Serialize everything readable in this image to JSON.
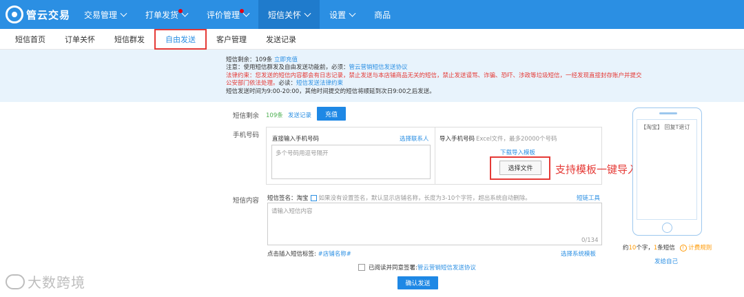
{
  "brand": {
    "logo_text": "管云交易"
  },
  "topnav": [
    {
      "label": "交易管理",
      "caret": true,
      "dot": false
    },
    {
      "label": "打单发货",
      "caret": true,
      "dot": true
    },
    {
      "label": "评价管理",
      "caret": true,
      "dot": true
    },
    {
      "label": "短信关怀",
      "caret": true,
      "dot": false
    },
    {
      "label": "设置",
      "caret": true,
      "dot": false
    },
    {
      "label": "商品",
      "caret": false,
      "dot": false
    }
  ],
  "subtabs": [
    "短信首页",
    "订单关怀",
    "短信群发",
    "自由发送",
    "客户管理",
    "发送记录"
  ],
  "notice": {
    "line1_prefix": "短信剩余：109条 ",
    "line1_link": "立即充值",
    "line2_prefix": "注意：使用短信群发及自由发送功能前，必须：",
    "line2_link": "管云营销短信发送协议",
    "line3": "法律约束：您发送的短信内容都会有日志记录，禁止发送与本店铺商品无关的短信，禁止发送谩骂、诈骗、恐吓、涉政等垃圾短信，一经发现直接封存账户并提交",
    "line4_red": "公安部门依法处理。",
    "line4_mid": "必读：",
    "line4_link": "短信发送法律约束",
    "line5": "短信发送时间为9:00-20:00，其他时间提交的短信将顺延到次日9:00之后发送。"
  },
  "form": {
    "balance_label": "短信剩余",
    "balance_value": "109条",
    "send_record_link": "发送记录",
    "recharge_button": "充值",
    "phone_label": "手机号码",
    "direct_input_title": "直接输入手机号码",
    "choose_contact_link": "选择联系人",
    "phone_placeholder": "多个号码用逗号隔开",
    "import_title": "导入手机号码",
    "import_hint": "Excel文件，最多20000个号码",
    "download_template_link": "下载导入模板",
    "choose_file_button": "选择文件",
    "content_label": "短信内容",
    "signature_label": "短信签名：淘宝",
    "signature_hint": "如果没有设置签名，默认显示店铺名称，长度为3-10个字符，超出系统自动删除。",
    "short_link_tool": "短链工具",
    "content_placeholder": "请输入短信内容",
    "counter": "0/134",
    "insert_tag_label": "点击插入短信标签: ",
    "insert_tag_value": "#店铺名称#",
    "choose_template_link": "选择系统模板",
    "agree_text": "已阅读并同意签署:",
    "agree_link": "管云营销短信发送协议",
    "confirm_button": "确认发送"
  },
  "phone_preview": {
    "content": "【淘宝】 回复T退订",
    "stats_prefix": "约",
    "stats_chars": "10",
    "stats_mid": "个字，",
    "stats_count": "1",
    "stats_suffix": "条短信",
    "billing_rule": "计费规则",
    "send_self": "发给自己"
  },
  "annotation": "支持模板一键导入",
  "watermark": "大数跨境"
}
